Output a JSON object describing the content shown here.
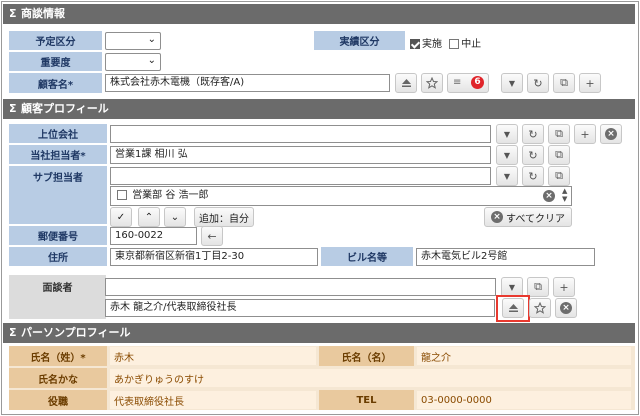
{
  "sections": {
    "deal": "商談情報",
    "customer": "顧客プロフィール",
    "person": "パーソンプロフィール",
    "sigma": "Σ"
  },
  "deal": {
    "scheduled_label": "予定区分",
    "importance_label": "重要度",
    "result_label": "実績区分",
    "done_label": "実施",
    "cancel_label": "中止",
    "customer_label": "顧客名*",
    "customer_value": "株式会社赤木電機（既存客/A)",
    "badge_count": "6"
  },
  "customer": {
    "parent_label": "上位会社",
    "rep_label": "当社担当者*",
    "rep_value": "営業1課 相川 弘",
    "sub_label": "サブ担当者",
    "sub_item": "営業部 谷 浩一郎",
    "add_self": "追加：自分",
    "clear_all": "すべてクリア",
    "zip_label": "郵便番号",
    "zip_value": "160-0022",
    "addr_label": "住所",
    "addr_value": "東京都新宿区新宿1丁目2-30",
    "bldg_label": "ビル名等",
    "bldg_value": "赤木電気ビル2号館"
  },
  "meeting": {
    "label": "面談者",
    "value": "赤木 龍之介/代表取締役社長"
  },
  "person": {
    "last_label": "氏名（姓）*",
    "last_value": "赤木",
    "first_label": "氏名（名）",
    "first_value": "龍之介",
    "kana_label": "氏名かな",
    "kana_value": "あかぎりゅうのすけ",
    "title_label": "役職",
    "title_value": "代表取締役社長",
    "tel_label": "TEL",
    "tel_value": "03-0000-0000"
  }
}
